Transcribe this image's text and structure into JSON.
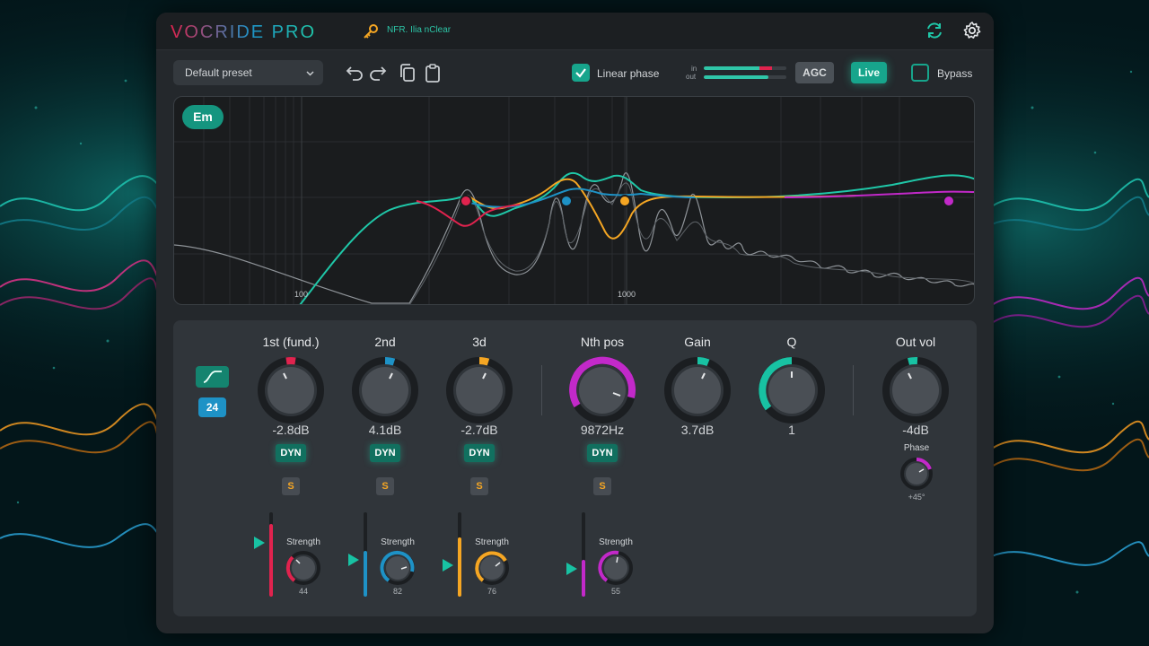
{
  "header": {
    "logo_text": "VOCRIDE PRO",
    "license": "NFR. Ilia nClear"
  },
  "toolbar": {
    "preset": "Default preset",
    "linear_phase_label": "Linear phase",
    "linear_phase_checked": true,
    "meter_in_label": "in",
    "meter_out_label": "out",
    "meter_in_level": 0.82,
    "meter_out_level": 0.78,
    "agc_label": "AGC",
    "live_label": "Live",
    "bypass_label": "Bypass",
    "bypass_checked": false
  },
  "display": {
    "badge": "Em",
    "freq_labels": [
      "100",
      "1000"
    ]
  },
  "controls": {
    "slope": "24",
    "bands": [
      {
        "label": "1st (fund.)",
        "value": "-2.8dB",
        "color": "#e0234e",
        "dyn": "DYN",
        "solo": "S",
        "strength_label": "Strength",
        "strength": "44",
        "level": 0.86
      },
      {
        "label": "2nd",
        "value": "4.1dB",
        "color": "#1e92c6",
        "dyn": "DYN",
        "solo": "S",
        "strength_label": "Strength",
        "strength": "82",
        "level": 0.54
      },
      {
        "label": "3d",
        "value": "-2.7dB",
        "color": "#f5a623",
        "dyn": "DYN",
        "solo": "S",
        "strength_label": "Strength",
        "strength": "76",
        "level": 0.7
      },
      {
        "label": "Nth pos",
        "value": "9872Hz",
        "color": "#c229c9",
        "dyn": "DYN",
        "solo": "S",
        "strength_label": "Strength",
        "strength": "55",
        "level": 0.44
      }
    ],
    "gain": {
      "label": "Gain",
      "value": "3.7dB",
      "color": "#18c2a3"
    },
    "q": {
      "label": "Q",
      "value": "1",
      "color": "#18c2a3"
    },
    "out_vol": {
      "label": "Out vol",
      "value": "-4dB",
      "color": "#18c2a3"
    },
    "phase": {
      "label": "Phase",
      "value": "+45°",
      "color": "#c229c9"
    }
  }
}
